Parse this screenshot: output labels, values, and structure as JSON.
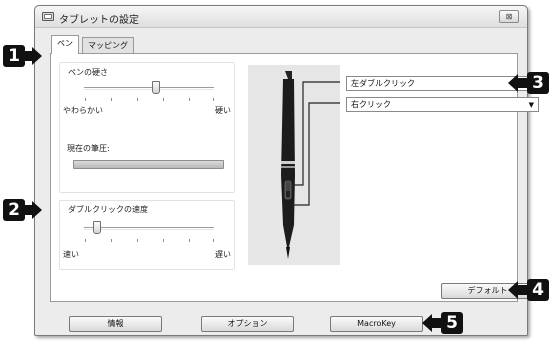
{
  "window": {
    "title": "タブレットの設定",
    "close_label": "⊠"
  },
  "tabs": [
    {
      "label": "ペン"
    },
    {
      "label": "マッピング"
    }
  ],
  "pen": {
    "firmness_label": "ペンの硬さ",
    "soft_label": "やわらかい",
    "hard_label": "硬い",
    "firmness_level": 0.55,
    "current_pressure_label": "現在の筆圧:"
  },
  "double_click": {
    "speed_label": "ダブルクリックの速度",
    "fast_label": "速い",
    "slow_label": "遅い",
    "speed_level": 0.1
  },
  "buttons": {
    "upper": {
      "value": "左ダブルクリック"
    },
    "lower": {
      "value": "右クリック"
    }
  },
  "default_button": "デフォルト",
  "footer": {
    "info": "情報",
    "options": "オプション",
    "macrokey": "MacroKey"
  },
  "callouts": [
    "1",
    "2",
    "3",
    "4",
    "5"
  ],
  "colors": {
    "callout": "#111111",
    "window_bg": "#ececec"
  }
}
